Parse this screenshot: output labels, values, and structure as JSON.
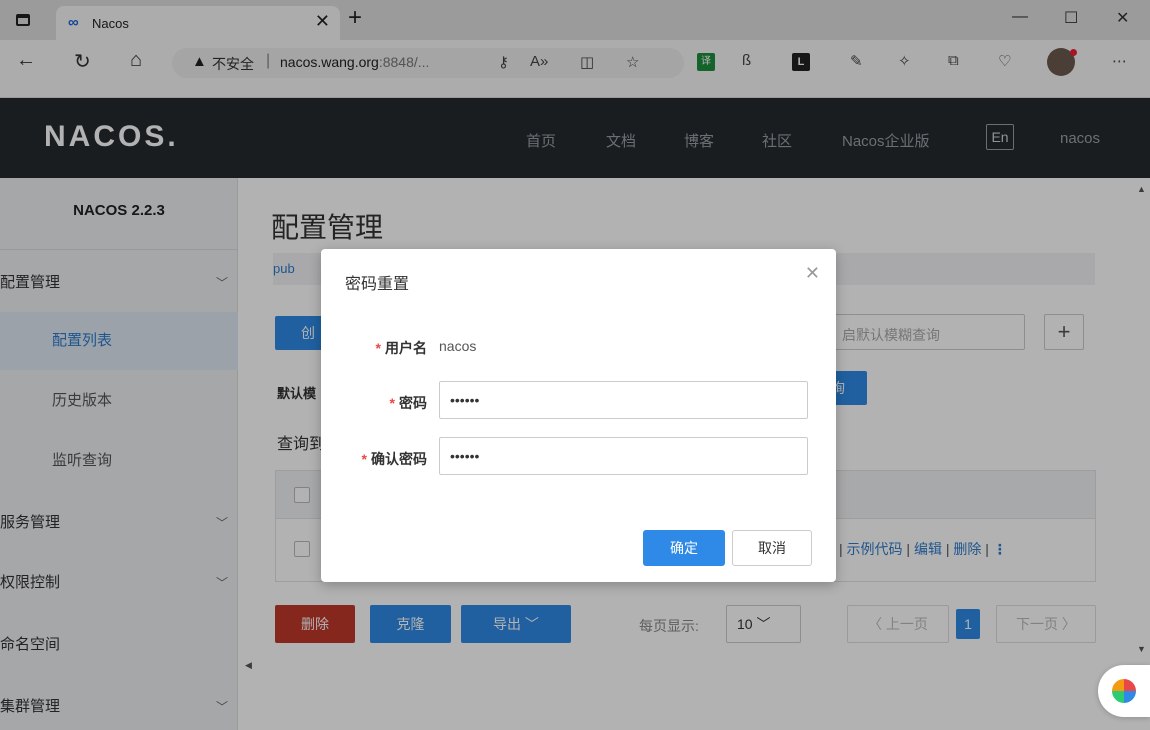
{
  "browser": {
    "tab_title": "Nacos",
    "new_tab": "+",
    "minimize": "—",
    "maximize": "☐",
    "close": "✕",
    "url_insecure": "不安全",
    "url_host": "nacos.wang.org",
    "url_path": ":8848/...",
    "ext_green_label": "译",
    "ext_dark_label": "L"
  },
  "header": {
    "logo": "NACOS.",
    "nav": [
      "首页",
      "文档",
      "博客",
      "社区",
      "Nacos企业版"
    ],
    "lang": "En",
    "user": "nacos"
  },
  "sidebar": {
    "version": "NACOS 2.2.3",
    "items": [
      {
        "label": "配置管理",
        "chevron": "﹀"
      },
      {
        "label": "配置列表"
      },
      {
        "label": "历史版本"
      },
      {
        "label": "监听查询"
      },
      {
        "label": "服务管理",
        "chevron": "﹀"
      },
      {
        "label": "权限控制",
        "chevron": "﹀"
      },
      {
        "label": "命名空间"
      },
      {
        "label": "集群管理",
        "chevron": "﹀"
      }
    ]
  },
  "main": {
    "title": "配置管理",
    "namespace_tab": "pub",
    "create_btn": "创",
    "fuzzy_placeholder": "启默认模糊查询",
    "plus": "+",
    "default_label": "默认模",
    "query_btn_fragment": "询",
    "result_label": "查询到",
    "row_ops": {
      "sep1": "|",
      "sample_code": "示例代码",
      "sep2": "|",
      "edit": "编辑",
      "sep3": "|",
      "delete": "删除",
      "sep4": "|",
      "more": "⋮"
    },
    "delete_btn": "删除",
    "clone_btn": "克隆",
    "export_btn": "导出 ﹀",
    "per_page_label": "每页显示:",
    "per_page_value": "10 ﹀",
    "prev_page": "〈 上一页",
    "current_page": "1",
    "next_page": "下一页 〉"
  },
  "modal": {
    "title": "密码重置",
    "close": "✕",
    "username_label": "用户名",
    "username_value": "nacos",
    "password_label": "密码",
    "password_value": "••••••",
    "confirm_label": "确认密码",
    "confirm_value": "••••••",
    "required_mark": "*",
    "ok": "确定",
    "cancel": "取消"
  },
  "colors": {
    "primary": "#2e8ae6",
    "danger": "#c0392b",
    "header_bg": "#252a2f",
    "required": "#e84848"
  }
}
